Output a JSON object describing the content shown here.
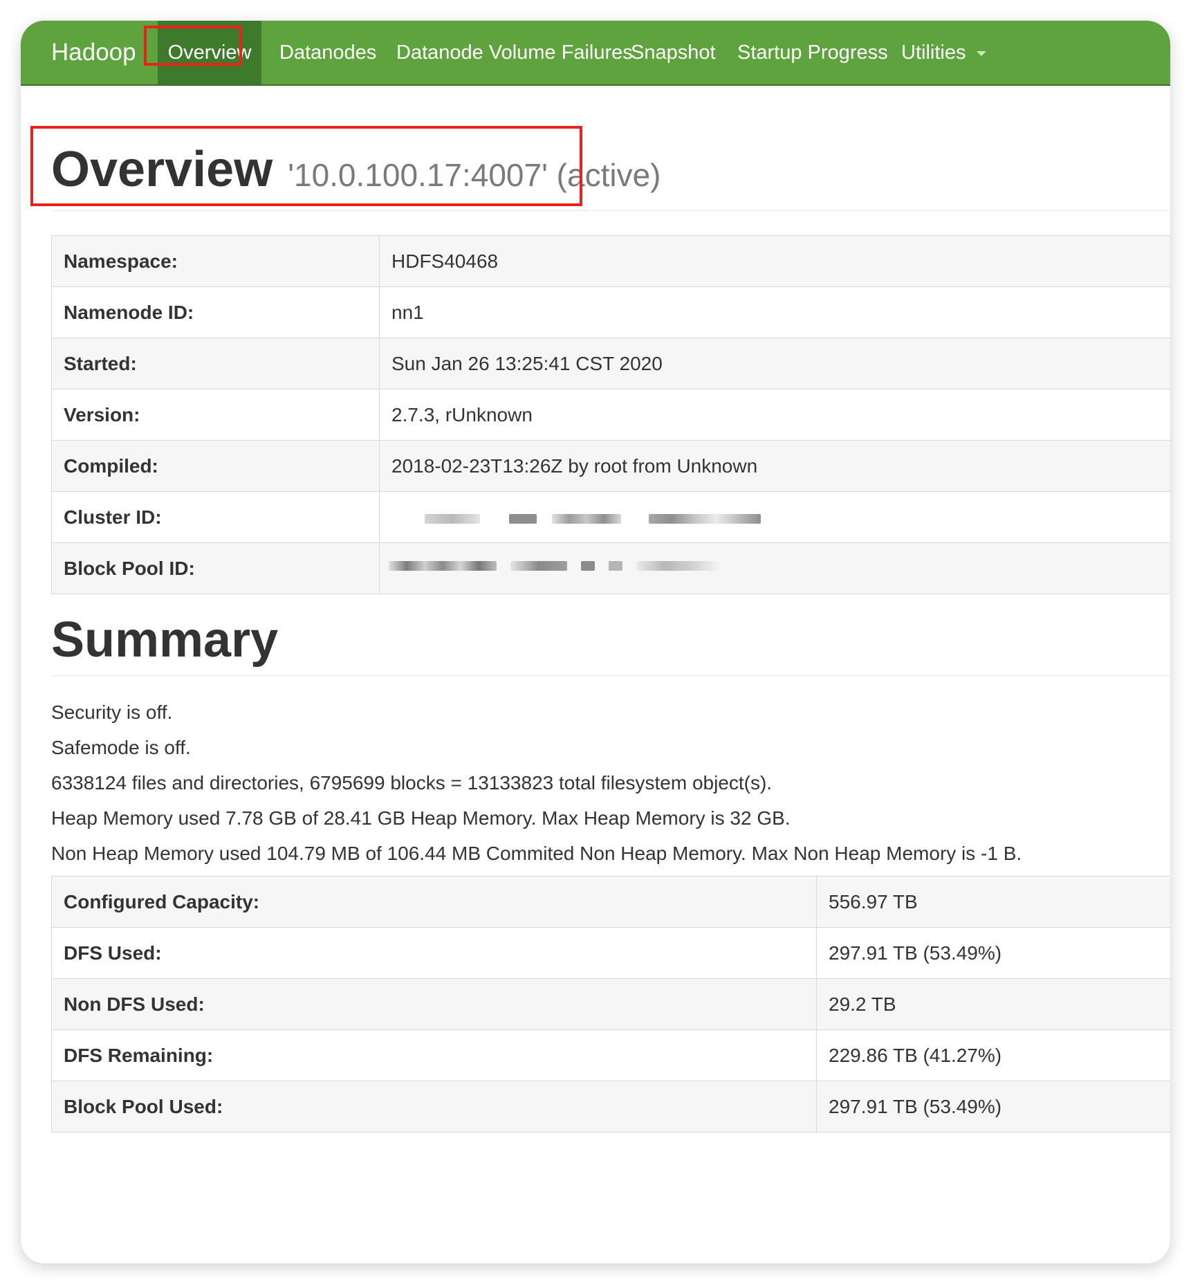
{
  "navbar": {
    "brand": "Hadoop",
    "items": [
      {
        "label": "Overview",
        "active": true
      },
      {
        "label": "Datanodes"
      },
      {
        "label": "Datanode Volume Failures"
      },
      {
        "label": "Snapshot"
      },
      {
        "label": "Startup Progress"
      },
      {
        "label": "Utilities",
        "dropdown": true
      }
    ],
    "color": "#5fa33e",
    "active_color": "#3d7a2b"
  },
  "header": {
    "title": "Overview",
    "subtitle": "'10.0.100.17:4007' (active)"
  },
  "overview_table": [
    {
      "label": "Namespace:",
      "value": "HDFS40468"
    },
    {
      "label": "Namenode ID:",
      "value": "nn1"
    },
    {
      "label": "Started:",
      "value": "Sun Jan 26 13:25:41 CST 2020"
    },
    {
      "label": "Version:",
      "value": "2.7.3, rUnknown"
    },
    {
      "label": "Compiled:",
      "value": "2018-02-23T13:26Z by root from Unknown"
    },
    {
      "label": "Cluster ID:",
      "value": null,
      "redacted": true
    },
    {
      "label": "Block Pool ID:",
      "value": null,
      "redacted": true
    }
  ],
  "summary": {
    "title": "Summary",
    "lines": [
      "Security is off.",
      "Safemode is off.",
      "6338124 files and directories, 6795699 blocks = 13133823 total filesystem object(s).",
      "Heap Memory used 7.78 GB of 28.41 GB Heap Memory. Max Heap Memory is 32 GB.",
      "Non Heap Memory used 104.79 MB of 106.44 MB Commited Non Heap Memory. Max Non Heap Memory is -1 B."
    ],
    "table": [
      {
        "label": "Configured Capacity:",
        "value": "556.97 TB"
      },
      {
        "label": "DFS Used:",
        "value": "297.91 TB (53.49%)"
      },
      {
        "label": "Non DFS Used:",
        "value": "29.2 TB"
      },
      {
        "label": "DFS Remaining:",
        "value": "229.86 TB (41.27%)"
      },
      {
        "label": "Block Pool Used:",
        "value": "297.91 TB (53.49%)"
      }
    ]
  },
  "highlight_color": "#e8231b"
}
